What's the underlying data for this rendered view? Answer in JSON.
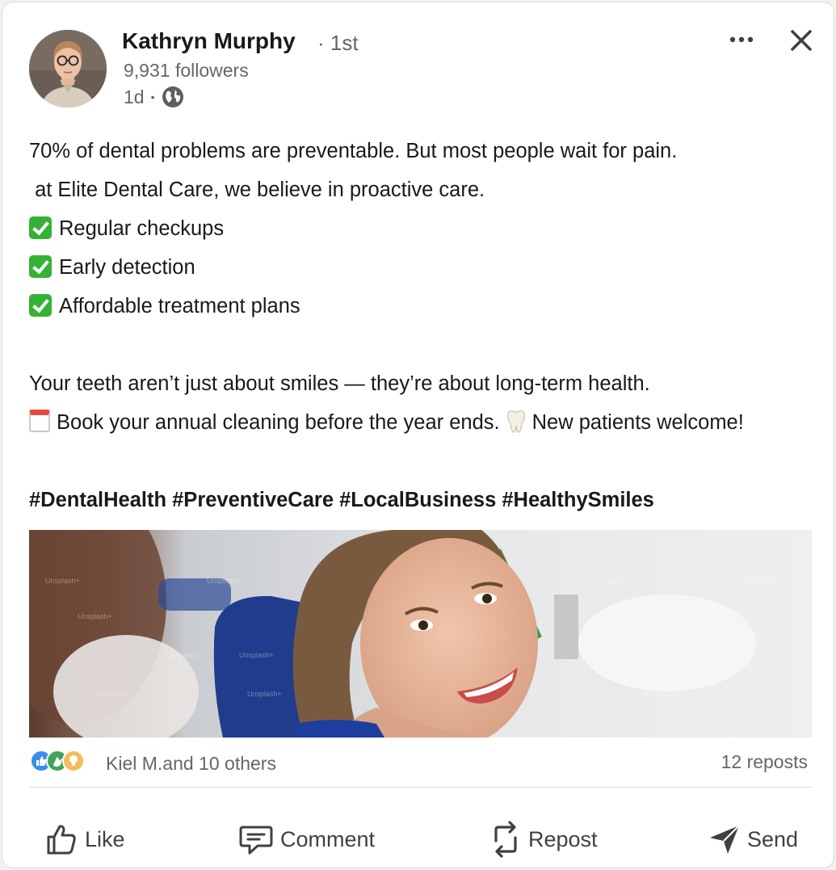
{
  "post": {
    "author": {
      "name": "Kathryn Murphy",
      "degree": "· 1st",
      "followers": "9,931 followers",
      "time": "1d",
      "separator": "•",
      "visibility_icon": "globe-icon"
    },
    "menu_icon": "more-horizontal-icon",
    "close_icon": "close-icon",
    "body": {
      "line1": "70% of dental problems are preventable. But most people wait for pain.",
      "line2": " at Elite Dental Care, we believe in proactive care.",
      "check1": "Regular checkups",
      "check2": "Early detection",
      "check3": "Affordable treatment plans",
      "line3": "Your teeth aren’t just about smiles — they’re about long-term health.",
      "line4a": "Book your annual cleaning before the year ends.",
      "line4b": "New patients welcome!",
      "hashtags": "#DentalHealth #PreventiveCare #LocalBusiness #HealthySmiles"
    },
    "image": {
      "description_icon": "photo-smiling-patient",
      "watermark": "Unsplash+"
    },
    "social": {
      "reactions_text": "Kiel M.and 10 others",
      "reposts_text": "12 reposts",
      "reaction_icons": [
        "like-reaction-icon",
        "celebrate-reaction-icon",
        "insightful-reaction-icon"
      ]
    },
    "actions": {
      "like": "Like",
      "comment": "Comment",
      "repost": "Repost",
      "send": "Send"
    }
  },
  "colors": {
    "text_primary": "#191919",
    "text_secondary": "#666666",
    "like_blue": "#378fe9",
    "celebrate_green": "#44a35a",
    "insight_yellow": "#f5bb5c",
    "check_green": "#34b233"
  }
}
